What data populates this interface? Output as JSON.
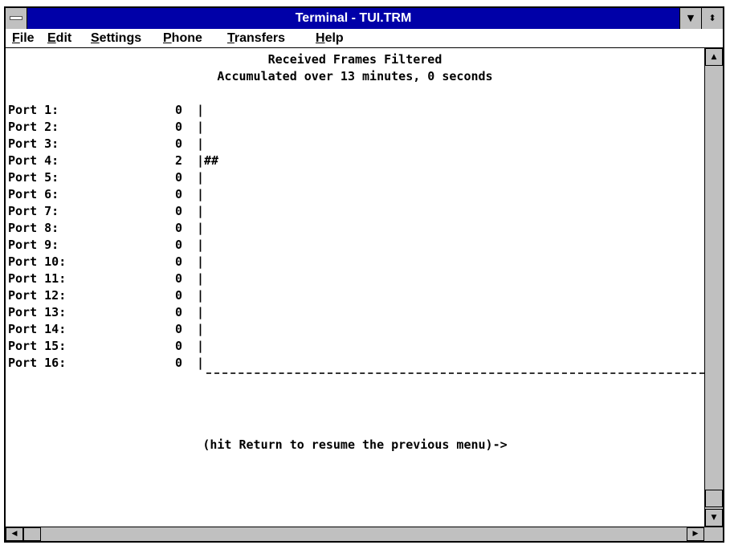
{
  "window": {
    "title": "Terminal - TUI.TRM"
  },
  "menu": [
    {
      "label": "File",
      "accel": "F",
      "rest": "ile"
    },
    {
      "label": "Edit",
      "accel": "E",
      "rest": "dit"
    },
    {
      "label": "Settings",
      "accel": "S",
      "rest": "ettings"
    },
    {
      "label": "Phone",
      "accel": "P",
      "rest": "hone"
    },
    {
      "label": "Transfers",
      "accel": "T",
      "rest": "ransfers"
    },
    {
      "label": "Help",
      "accel": "H",
      "rest": "elp"
    }
  ],
  "terminal": {
    "heading": "Received Frames Filtered",
    "subheading": "Accumulated over 13 minutes, 0 seconds",
    "ports": [
      {
        "label": "Port 1:",
        "value": "0",
        "bar": "|"
      },
      {
        "label": "Port 2:",
        "value": "0",
        "bar": "|"
      },
      {
        "label": "Port 3:",
        "value": "0",
        "bar": "|"
      },
      {
        "label": "Port 4:",
        "value": "2",
        "bar": "|##"
      },
      {
        "label": "Port 5:",
        "value": "0",
        "bar": "|"
      },
      {
        "label": "Port 6:",
        "value": "0",
        "bar": "|"
      },
      {
        "label": "Port 7:",
        "value": "0",
        "bar": "|"
      },
      {
        "label": "Port 8:",
        "value": "0",
        "bar": "|"
      },
      {
        "label": "Port 9:",
        "value": "0",
        "bar": "|"
      },
      {
        "label": "Port 10:",
        "value": "0",
        "bar": "|"
      },
      {
        "label": "Port 11:",
        "value": "0",
        "bar": "|"
      },
      {
        "label": "Port 12:",
        "value": "0",
        "bar": "|"
      },
      {
        "label": "Port 13:",
        "value": "0",
        "bar": "|"
      },
      {
        "label": "Port 14:",
        "value": "0",
        "bar": "|"
      },
      {
        "label": "Port 15:",
        "value": "0",
        "bar": "|"
      },
      {
        "label": "Port 16:",
        "value": "0",
        "bar": "|"
      }
    ],
    "prompt": "(hit Return to resume the previous menu)->"
  },
  "icons": {
    "system_menu": "system-menu-icon",
    "minimize": "minimize-arrow-icon",
    "maximize": "maximize-arrow-icon",
    "scroll_up": "scroll-up-arrow-icon",
    "scroll_down": "scroll-down-arrow-icon",
    "scroll_left": "scroll-left-arrow-icon",
    "scroll_right": "scroll-right-arrow-icon"
  },
  "colors": {
    "titlebar": "#0000a8",
    "titlebar_text": "#ffffff",
    "chrome": "#c0c0c0",
    "terminal_bg": "#ffffff",
    "terminal_text": "#000000"
  }
}
